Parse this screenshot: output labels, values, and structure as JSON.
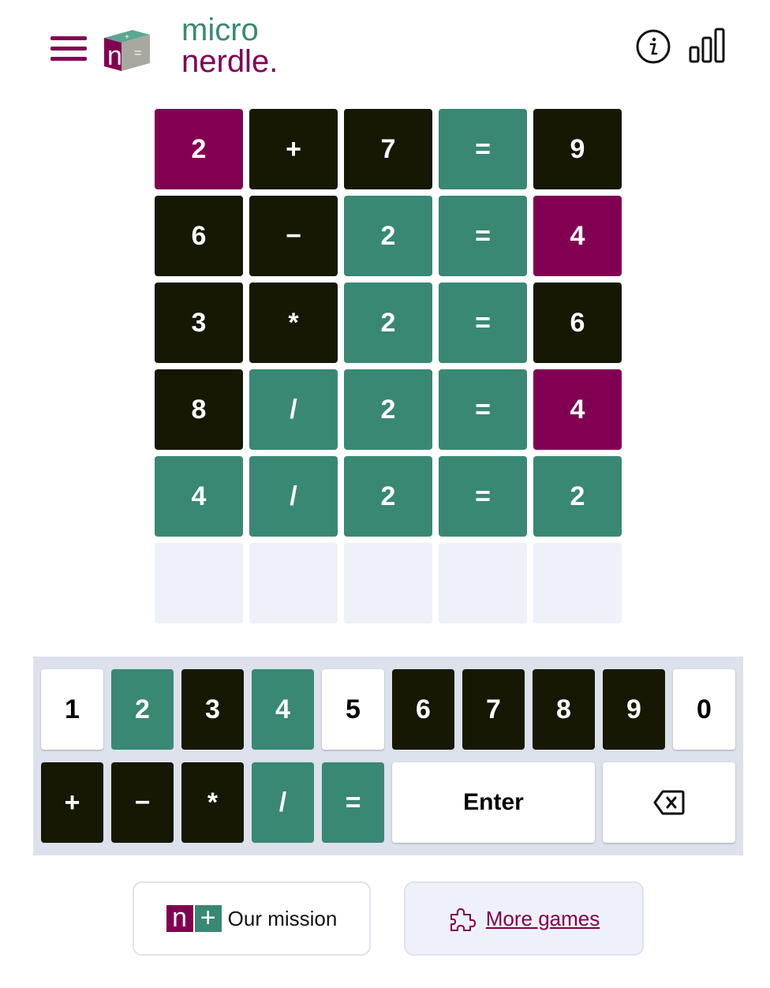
{
  "app": {
    "logo_line1": "micro",
    "logo_line2": "nerdle."
  },
  "icons": {
    "menu": "hamburger-menu-icon",
    "info": "info-icon",
    "stats": "stats-icon",
    "backspace": "backspace-icon",
    "puzzle": "puzzle-icon"
  },
  "colors": {
    "purple": "#820052",
    "dark": "#161803",
    "green": "#398874",
    "empty": "#eff1f9"
  },
  "board": {
    "rows": [
      [
        {
          "c": "2",
          "s": "purple"
        },
        {
          "c": "+",
          "s": "dark"
        },
        {
          "c": "7",
          "s": "dark"
        },
        {
          "c": "=",
          "s": "green"
        },
        {
          "c": "9",
          "s": "dark"
        }
      ],
      [
        {
          "c": "6",
          "s": "dark"
        },
        {
          "c": "−",
          "s": "dark"
        },
        {
          "c": "2",
          "s": "green"
        },
        {
          "c": "=",
          "s": "green"
        },
        {
          "c": "4",
          "s": "purple"
        }
      ],
      [
        {
          "c": "3",
          "s": "dark"
        },
        {
          "c": "*",
          "s": "dark"
        },
        {
          "c": "2",
          "s": "green"
        },
        {
          "c": "=",
          "s": "green"
        },
        {
          "c": "6",
          "s": "dark"
        }
      ],
      [
        {
          "c": "8",
          "s": "dark"
        },
        {
          "c": "/",
          "s": "green"
        },
        {
          "c": "2",
          "s": "green"
        },
        {
          "c": "=",
          "s": "green"
        },
        {
          "c": "4",
          "s": "purple"
        }
      ],
      [
        {
          "c": "4",
          "s": "green"
        },
        {
          "c": "/",
          "s": "green"
        },
        {
          "c": "2",
          "s": "green"
        },
        {
          "c": "=",
          "s": "green"
        },
        {
          "c": "2",
          "s": "green"
        }
      ],
      [
        {
          "c": "",
          "s": "empty"
        },
        {
          "c": "",
          "s": "empty"
        },
        {
          "c": "",
          "s": "empty"
        },
        {
          "c": "",
          "s": "empty"
        },
        {
          "c": "",
          "s": "empty"
        }
      ]
    ]
  },
  "keyboard": {
    "row1": [
      {
        "k": "1",
        "s": "white"
      },
      {
        "k": "2",
        "s": "green"
      },
      {
        "k": "3",
        "s": "dark"
      },
      {
        "k": "4",
        "s": "green"
      },
      {
        "k": "5",
        "s": "white"
      },
      {
        "k": "6",
        "s": "dark"
      },
      {
        "k": "7",
        "s": "dark"
      },
      {
        "k": "8",
        "s": "dark"
      },
      {
        "k": "9",
        "s": "dark"
      },
      {
        "k": "0",
        "s": "white"
      }
    ],
    "row2": [
      {
        "k": "+",
        "s": "dark"
      },
      {
        "k": "−",
        "s": "dark"
      },
      {
        "k": "*",
        "s": "dark"
      },
      {
        "k": "/",
        "s": "green"
      },
      {
        "k": "=",
        "s": "green"
      }
    ],
    "enter_label": "Enter"
  },
  "footer": {
    "mission_n": "n",
    "mission_plus": "+",
    "mission_label": "Our mission",
    "games_label": "More games"
  }
}
